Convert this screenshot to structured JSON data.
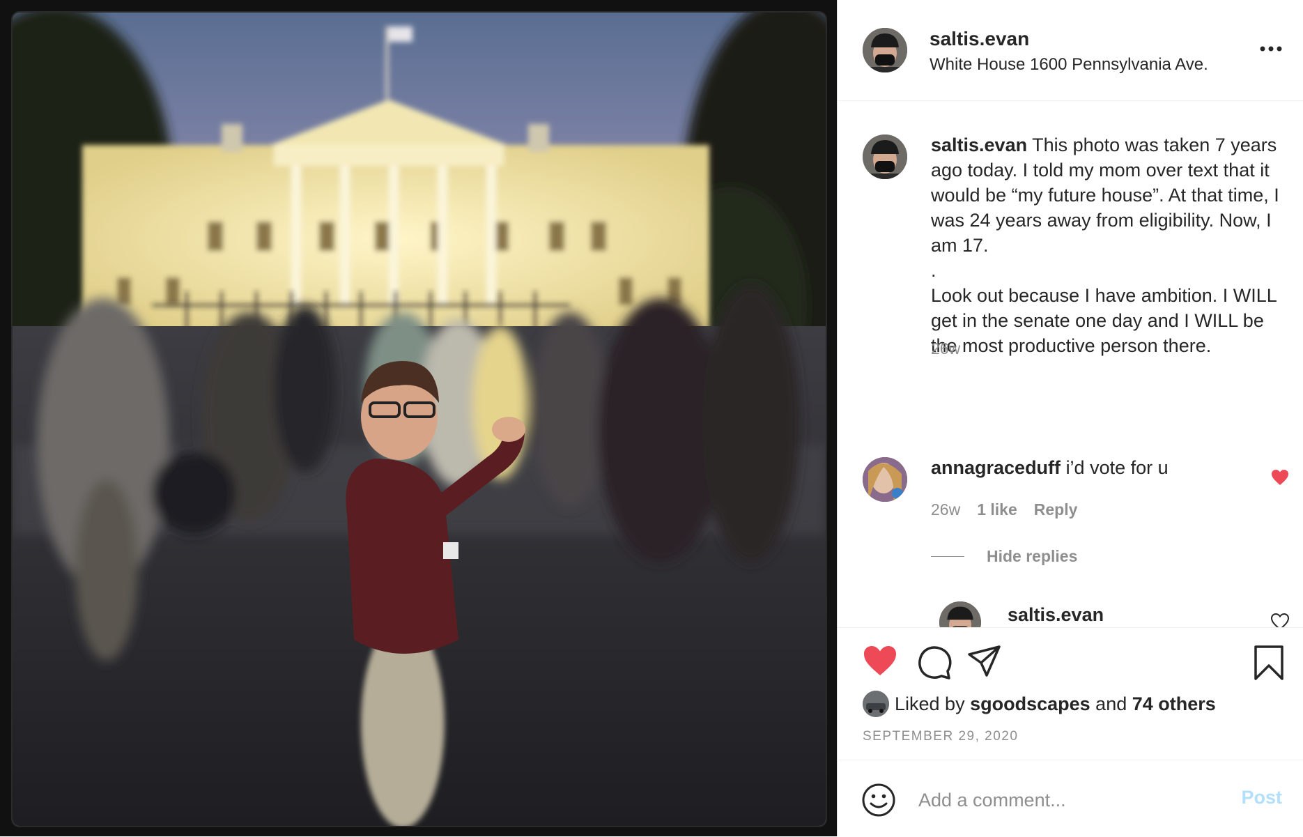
{
  "post": {
    "username": "saltis.evan",
    "location": "White House 1600 Pennsylvania Ave.",
    "more_icon": "more-horizontal-icon"
  },
  "caption": {
    "username": "saltis.evan",
    "text": "This photo was taken 7 years ago today. I told my mom over text that it would be “my future house”. At that time, I was 24 years away from eligibility. Now, I am 17.\n.\nLook out because I have ambition. I WILL get in the senate one day and I WILL be the most productive person there.",
    "time": "26w"
  },
  "comment": {
    "username": "annagraceduff",
    "text": "i’d vote for u",
    "time": "26w",
    "likes": "1 like",
    "reply_label": "Reply",
    "liked": true,
    "heart_color": "#ed4956",
    "hide_replies": "Hide replies"
  },
  "reply": {
    "username": "saltis.evan"
  },
  "actions": {
    "liked": true,
    "like_color": "#ed4956",
    "liked_by_prefix": "Liked by",
    "liked_by_user": "sgoodscapes",
    "and_label": "and",
    "others": "74 others",
    "date": "SEPTEMBER 29, 2020"
  },
  "add_comment": {
    "placeholder": "Add a comment...",
    "post_label": "Post",
    "post_color": "#b2dffc"
  }
}
